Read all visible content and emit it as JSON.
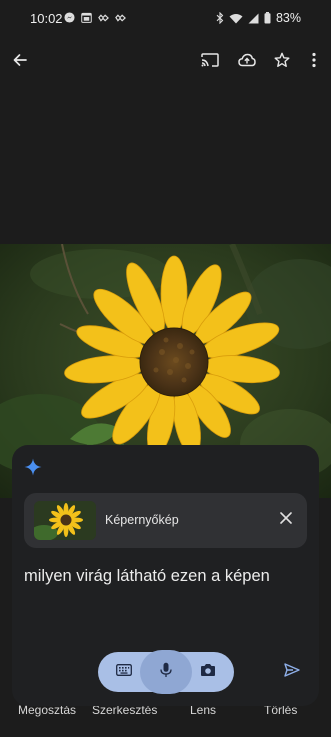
{
  "status_bar": {
    "time": "10:02",
    "battery": "83%",
    "notification_icons": [
      "messenger-icon",
      "calendar-icon",
      "heart-rate-icon",
      "heart-rate-icon"
    ],
    "system_icons": [
      "bluetooth-icon",
      "wifi-icon",
      "signal-icon",
      "battery-icon"
    ]
  },
  "toolbar": {
    "icons": [
      "back-arrow-icon",
      "cast-icon",
      "cloud-upload-icon",
      "star-icon",
      "more-vert-icon"
    ]
  },
  "bottom_actions": [
    "Megosztás",
    "Szerkesztés",
    "Lens",
    "Törlés"
  ],
  "gemini": {
    "attachment_label": "Képernyőkép",
    "prompt_text": "milyen virág látható ezen a képen",
    "input_icons": [
      "keyboard-icon",
      "mic-icon",
      "camera-icon"
    ],
    "send_icon": "send-icon"
  },
  "colors": {
    "background": "#1c1c1c",
    "sheet": "#1f2022",
    "chip": "#303134",
    "pill": "#a9bfe6",
    "accent_blue": "#4a8ff0",
    "petal": "#f3c11a"
  }
}
